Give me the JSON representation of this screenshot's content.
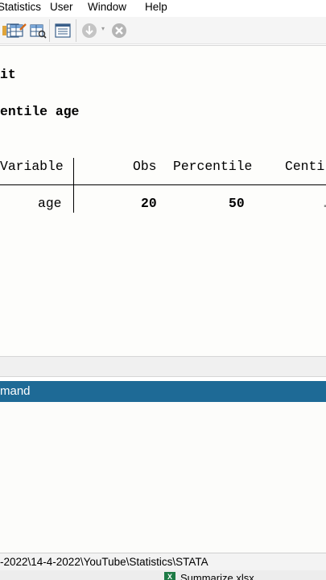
{
  "menu": {
    "statistics": "Statistics",
    "user": "User",
    "window": "Window",
    "help": "Help"
  },
  "toolbar": {
    "icons": [
      "variables-manager-icon",
      "data-editor-icon",
      "data-browser-icon",
      "log-viewer-icon",
      "more-icon",
      "break-icon"
    ],
    "dropdown_glyph": "▾"
  },
  "results": {
    "line1": "it",
    "line2": "entile age",
    "table": {
      "headers": [
        "Variable",
        "Obs",
        "Percentile",
        "Centi"
      ],
      "row": {
        "variable": "age",
        "obs": "20",
        "percentile": "50",
        "centile": "."
      }
    }
  },
  "command_panel": {
    "title": "mand"
  },
  "status": {
    "path": "-2022\\14-4-2022\\YouTube\\Statistics\\STATA"
  },
  "taskbar": {
    "item": "Summarize.xlsx",
    "icon_letter": "X"
  },
  "colors": {
    "accent": "#1e6a96",
    "excel": "#1d7a45"
  }
}
